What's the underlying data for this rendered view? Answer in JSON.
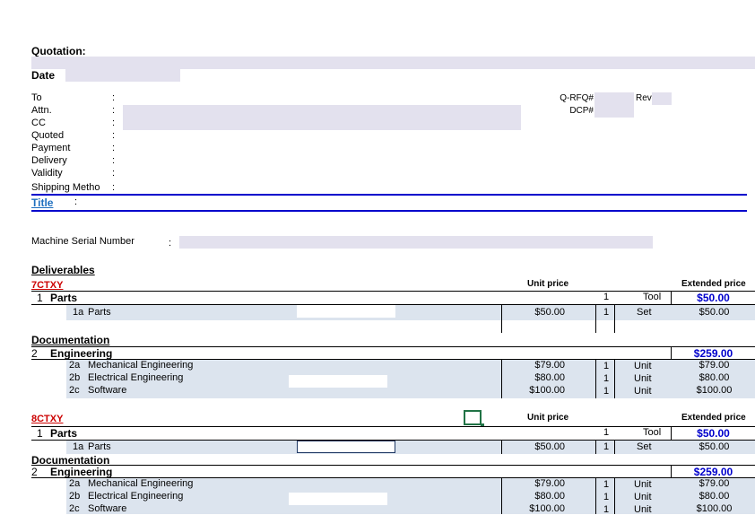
{
  "header": {
    "quotation_label": "Quotation:",
    "date_label": "Date"
  },
  "info_fields": [
    {
      "label": "To"
    },
    {
      "label": "Attn."
    },
    {
      "label": "CC"
    },
    {
      "label": "Quoted"
    },
    {
      "label": "Payment"
    },
    {
      "label": "Delivery"
    },
    {
      "label": "Validity"
    },
    {
      "label": "Shipping Metho"
    }
  ],
  "colon": ":",
  "right_fields": {
    "qrfq_label": "Q-RFQ#",
    "rev_label": "Rev",
    "dcp_label": "DCP#"
  },
  "title_label": "Title",
  "machine_serial_label": "Machine Serial Number",
  "deliverables_label": "Deliverables",
  "sections": [
    {
      "code": "7CTXY",
      "unit_price_header": "Unit price",
      "extended_price_header": "Extended price",
      "parts": {
        "num": "1",
        "name": "Parts",
        "qty": "1",
        "unit": "Tool",
        "total": "$50.00"
      },
      "parts_item": {
        "num": "1a",
        "name": "Parts",
        "price": "$50.00",
        "qty": "1",
        "unit": "Set",
        "ext": "$50.00"
      },
      "documentation_label": "Documentation",
      "engineering": {
        "num": "2",
        "name": "Engineering",
        "total": "$259.00"
      },
      "eng_items": [
        {
          "num": "2a",
          "name": "Mechanical Engineering",
          "price": "$79.00",
          "qty": "1",
          "unit": "Unit",
          "ext": "$79.00"
        },
        {
          "num": "2b",
          "name": "Electrical Engineering",
          "price": "$80.00",
          "qty": "1",
          "unit": "Unit",
          "ext": "$80.00"
        },
        {
          "num": "2c",
          "name": "Software",
          "price": "$100.00",
          "qty": "1",
          "unit": "Unit",
          "ext": "$100.00"
        }
      ]
    },
    {
      "code": "8CTXY",
      "unit_price_header": "Unit price",
      "extended_price_header": "Extended price",
      "parts": {
        "num": "1",
        "name": "Parts",
        "qty": "1",
        "unit": "Tool",
        "total": "$50.00"
      },
      "parts_item": {
        "num": "1a",
        "name": "Parts",
        "price": "$50.00",
        "qty": "1",
        "unit": "Set",
        "ext": "$50.00"
      },
      "documentation_label": "Documentation",
      "engineering": {
        "num": "2",
        "name": "Engineering",
        "total": "$259.00"
      },
      "eng_items": [
        {
          "num": "2a",
          "name": "Mechanical Engineering",
          "price": "$79.00",
          "qty": "1",
          "unit": "Unit",
          "ext": "$79.00"
        },
        {
          "num": "2b",
          "name": "Electrical Engineering",
          "price": "$80.00",
          "qty": "1",
          "unit": "Unit",
          "ext": "$80.00"
        },
        {
          "num": "2c",
          "name": "Software",
          "price": "$100.00",
          "qty": "1",
          "unit": "Unit",
          "ext": "$100.00"
        }
      ]
    }
  ]
}
